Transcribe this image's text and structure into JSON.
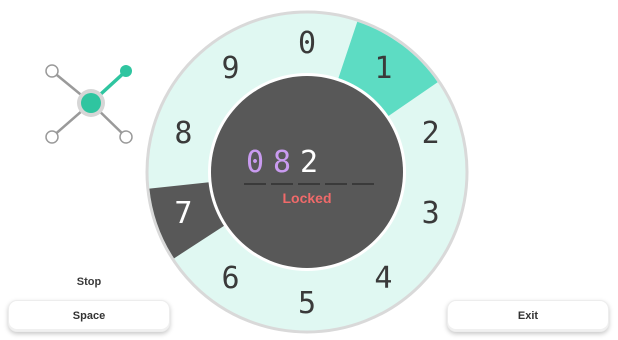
{
  "dial": {
    "numbers": [
      "0",
      "1",
      "2",
      "3",
      "4",
      "5",
      "6",
      "7",
      "8",
      "9"
    ],
    "highlighted_number": "1",
    "dark_number": "7",
    "colors": {
      "ring": "#e0f8f2",
      "ring_border": "#d9d9d9",
      "highlight": "#5ddcc3",
      "dark_segment": "#585858",
      "center": "#585858",
      "number": "#3a3a3a",
      "number_on_dark": "#ffffff"
    }
  },
  "display": {
    "entered_digits": "08",
    "current_digit": "2",
    "slots": 5,
    "status": "Locked",
    "colors": {
      "entered": "#c99bf0",
      "current": "#ffffff",
      "slot_line": "#3a3a3a",
      "status": "#f06a6a"
    }
  },
  "joystick": {
    "icon": "joystick-icon",
    "colors": {
      "accent": "#2fc5a0",
      "base": "#9a9a9a"
    }
  },
  "controls": {
    "hint_label": "Stop",
    "space_label": "Space",
    "exit_label": "Exit"
  }
}
